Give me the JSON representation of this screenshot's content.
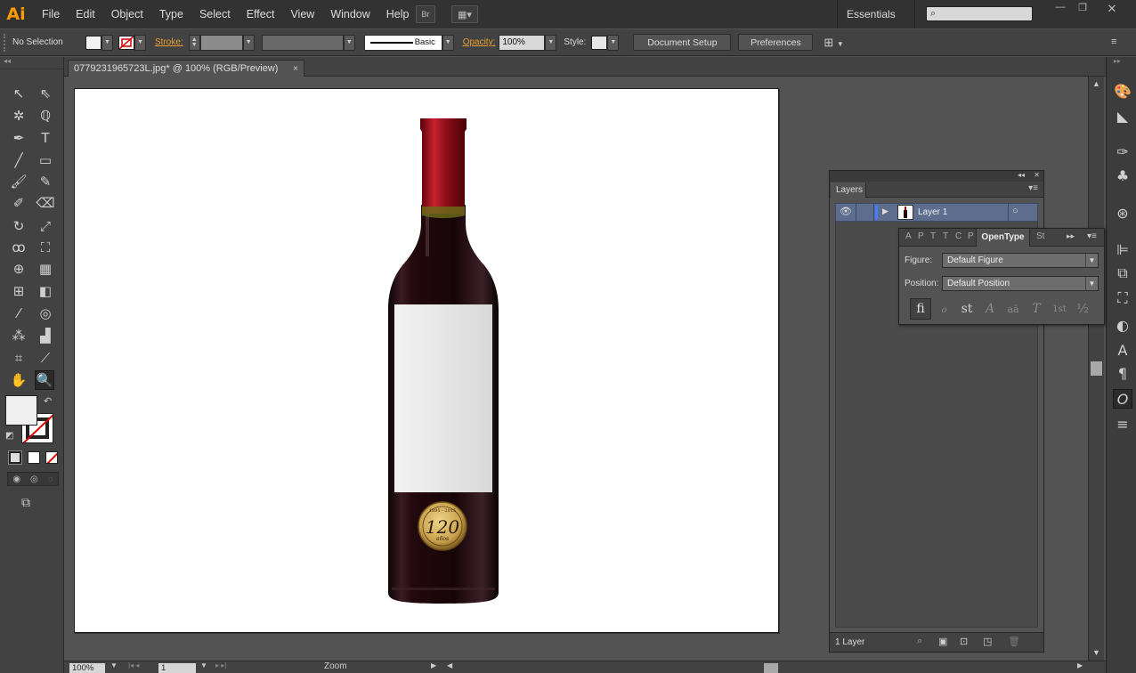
{
  "app": {
    "logo": "Ai"
  },
  "menu": [
    "File",
    "Edit",
    "Object",
    "Type",
    "Select",
    "Effect",
    "View",
    "Window",
    "Help"
  ],
  "menubar_buttons": {
    "bridge": "Br",
    "arrange": "▦▾"
  },
  "workspace": {
    "label": "Essentials",
    "arrow": "▾"
  },
  "window_controls": {
    "minimize": "—",
    "restore": "❐",
    "close": "✕"
  },
  "control_bar": {
    "selection": "No Selection",
    "stroke_label": "Stroke:",
    "brush": "Basic",
    "opacity_label": "Opacity:",
    "opacity_value": "100%",
    "style_label": "Style:",
    "document_setup": "Document Setup",
    "preferences": "Preferences"
  },
  "document_tab": {
    "title": "0779231965723L.jpg* @ 100% (RGB/Preview)",
    "close": "×"
  },
  "layers_panel": {
    "tab": "Layers",
    "layer_name": "Layer 1",
    "footer_count": "1 Layer"
  },
  "opentype_panel": {
    "mini_tabs": [
      "A",
      "P",
      "T",
      "T",
      "C",
      "P"
    ],
    "active_tab": "OpenType",
    "next_tab": "St",
    "figure_label": "Figure:",
    "figure_value": "Default Figure",
    "position_label": "Position:",
    "position_value": "Default Position",
    "glyphs": [
      "fi",
      "ℴ",
      "st",
      "A",
      "aā",
      "T",
      "1st",
      "½"
    ]
  },
  "status_bar": {
    "zoom": "100%",
    "artboard": "1",
    "tool_name": "Zoom"
  },
  "bottle_label": {
    "years_top": "1895 - 2015",
    "big": "120",
    "script": "años"
  },
  "colors": {
    "accent_orange": "#e8a030",
    "layer_select": "#5d6d8e",
    "layer_color": "#4a7bff"
  }
}
